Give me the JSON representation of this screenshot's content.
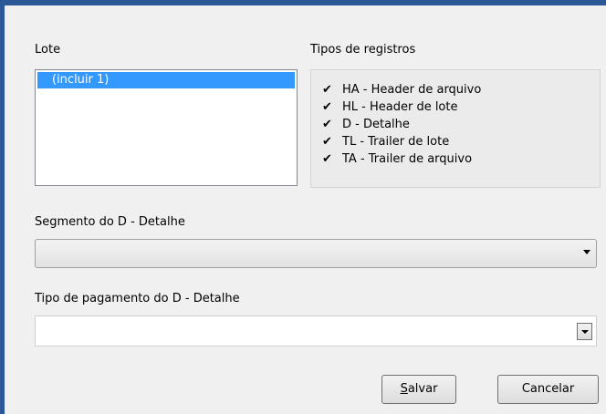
{
  "lote": {
    "label": "Lote",
    "items": [
      "(incluir 1)"
    ]
  },
  "tipos": {
    "label": "Tipos de registros",
    "check_icon": "check-icon",
    "items": [
      "HA - Header de arquivo",
      "HL - Header de lote",
      "D - Detalhe",
      "TL - Trailer de lote",
      "TA - Trailer de arquivo"
    ]
  },
  "segmento": {
    "label": "Segmento do D - Detalhe",
    "value": ""
  },
  "tipo_pagamento": {
    "label": "Tipo de pagamento do D - Detalhe",
    "value": ""
  },
  "buttons": {
    "save_mnemonic": "S",
    "save_rest": "alvar",
    "cancel": "Cancelar"
  },
  "colors": {
    "frame": "#2b5797",
    "selection": "#3399ff",
    "background": "#f0f0f0"
  }
}
